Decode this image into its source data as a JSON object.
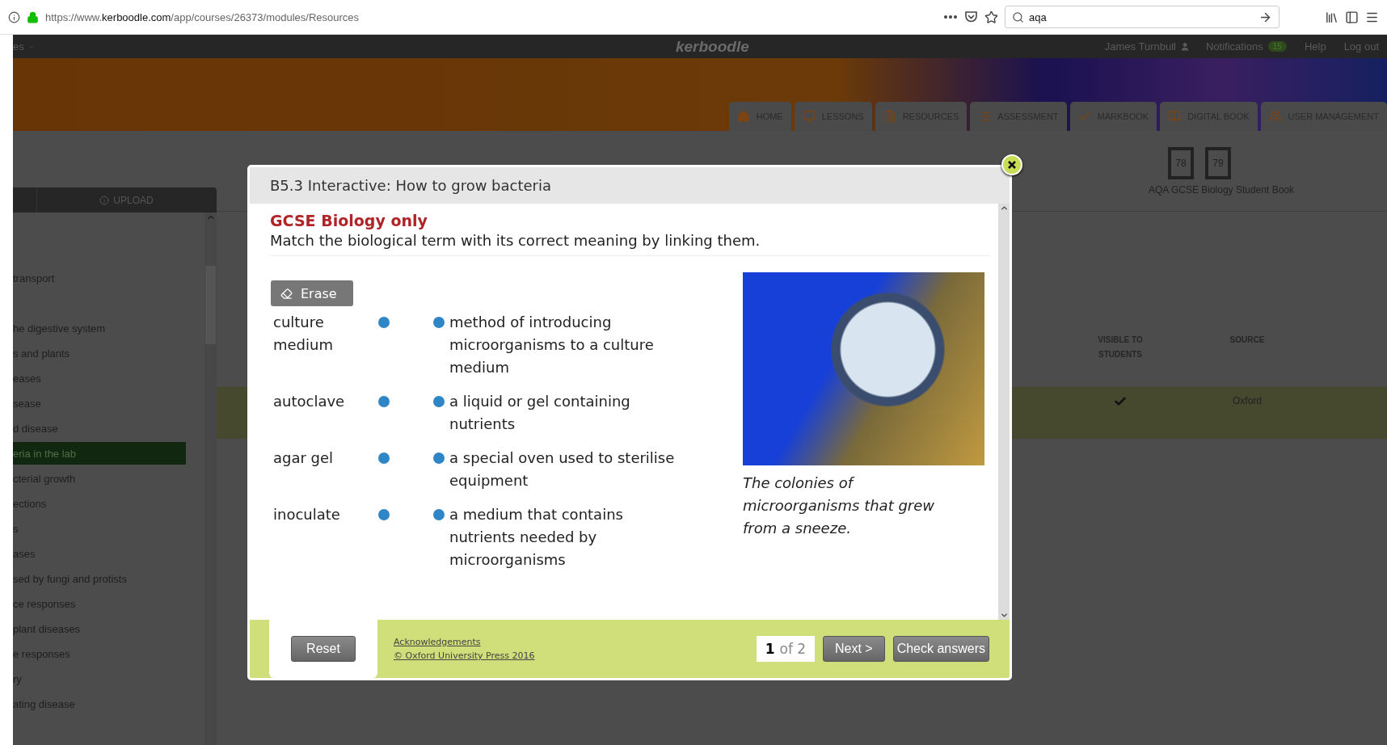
{
  "browser": {
    "url_prefix": "https://www.",
    "url_domain": "kerboodle.com",
    "url_path": "/app/courses/26373/modules/Resources",
    "search_value": "aqa"
  },
  "header": {
    "menu_label": "es",
    "logo": "kerboodle",
    "user": "James Turnbull",
    "notifications_label": "Notifications",
    "notifications_count": "15",
    "links": [
      "Help",
      "Log out"
    ]
  },
  "nav_tabs": [
    {
      "label": "HOME",
      "kind": "home"
    },
    {
      "label": "LESSONS",
      "kind": "lessons"
    },
    {
      "label": "RESOURCES",
      "kind": "resources"
    },
    {
      "label": "ASSESSMENT",
      "kind": "assessment"
    },
    {
      "label": "MARKBOOK",
      "kind": "markbook"
    },
    {
      "label": "DIGITAL BOOK",
      "kind": "book"
    },
    {
      "label": "USER MANAGEMENT",
      "kind": "users"
    }
  ],
  "sidebar": {
    "upload_label": "UPLOAD",
    "groups": [
      [
        {
          "text": "transport",
          "selected": false
        }
      ],
      [
        {
          "text": "he digestive system",
          "selected": false
        },
        {
          "text": "s and plants",
          "selected": false
        },
        {
          "text": "eases",
          "selected": false
        },
        {
          "text": "sease",
          "selected": false
        },
        {
          "text": "d disease",
          "selected": false
        },
        {
          "text": "eria in the lab",
          "selected": true
        },
        {
          "text": "cterial growth",
          "selected": false
        },
        {
          "text": "ections",
          "selected": false
        },
        {
          "text": "s",
          "selected": false
        },
        {
          "text": "ases",
          "selected": false
        },
        {
          "text": "sed by fungi and protists",
          "selected": false
        },
        {
          "text": "ce responses",
          "selected": false
        },
        {
          "text": "plant diseases",
          "selected": false
        },
        {
          "text": "e responses",
          "selected": false
        },
        {
          "text": "ry",
          "selected": false
        },
        {
          "text": "ating disease",
          "selected": false
        }
      ]
    ]
  },
  "book": {
    "pages": [
      "78",
      "79"
    ],
    "title": "AQA GCSE Biology Student Book"
  },
  "table": {
    "columns": [
      "VISIBLE TO STUDENTS",
      "SOURCE"
    ],
    "rows": [
      {
        "visible": true,
        "source": "Oxford",
        "selected": true
      }
    ]
  },
  "modal": {
    "title": "B5.3 Interactive: How to grow bacteria",
    "subtitle": "GCSE Biology only",
    "instruction": "Match the biological term with its correct meaning by linking them.",
    "erase_label": "Erase",
    "pairs": [
      {
        "term": "culture medium",
        "meaning": "method of introducing microorganisms to a culture medium"
      },
      {
        "term": "autoclave",
        "meaning": "a liquid or gel containing nutrients"
      },
      {
        "term": "agar gel",
        "meaning": "a special oven used to sterilise equipment"
      },
      {
        "term": "inoculate",
        "meaning": "a medium that contains nutrients needed by microorganisms"
      }
    ],
    "image_caption": "The colonies of microorganisms that grew from a sneeze.",
    "reset_label": "Reset",
    "acknowledgements": "Acknowledgements",
    "copyright": "© Oxford University Press 2016",
    "page_current": "1",
    "page_total": "of 2",
    "next_label": "Next >",
    "check_label": "Check answers"
  }
}
